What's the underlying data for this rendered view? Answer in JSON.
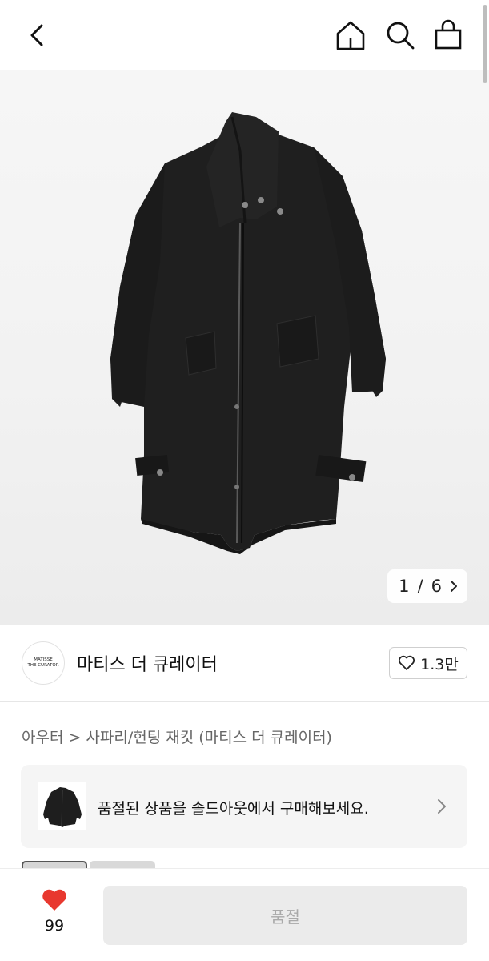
{
  "header": {
    "back_icon": "chevron-left-icon",
    "home_icon": "home-icon",
    "search_icon": "search-icon",
    "bag_icon": "shopping-bag-icon"
  },
  "gallery": {
    "current": "1",
    "separator": "/",
    "total": "6",
    "next_icon": "chevron-right-icon"
  },
  "brand": {
    "logo_line1": "MATISSE",
    "logo_line2": "THE CURATOR",
    "name": "마티스 더 큐레이터",
    "favorite_count": "1.3만",
    "favorite_icon": "heart-outline-icon"
  },
  "breadcrumb": {
    "category": "아우터",
    "separator": ">",
    "product": "사파리/헌팅 재킷 (마티스 더 큐레이터)"
  },
  "soldout_banner": {
    "message": "품절된 상품을 솔드아웃에서 구매해보세요.",
    "arrow_icon": "chevron-right-icon"
  },
  "bottom_bar": {
    "like_count": "99",
    "like_icon": "heart-filled-icon",
    "like_color": "#e8382f",
    "buy_label": "품절"
  }
}
